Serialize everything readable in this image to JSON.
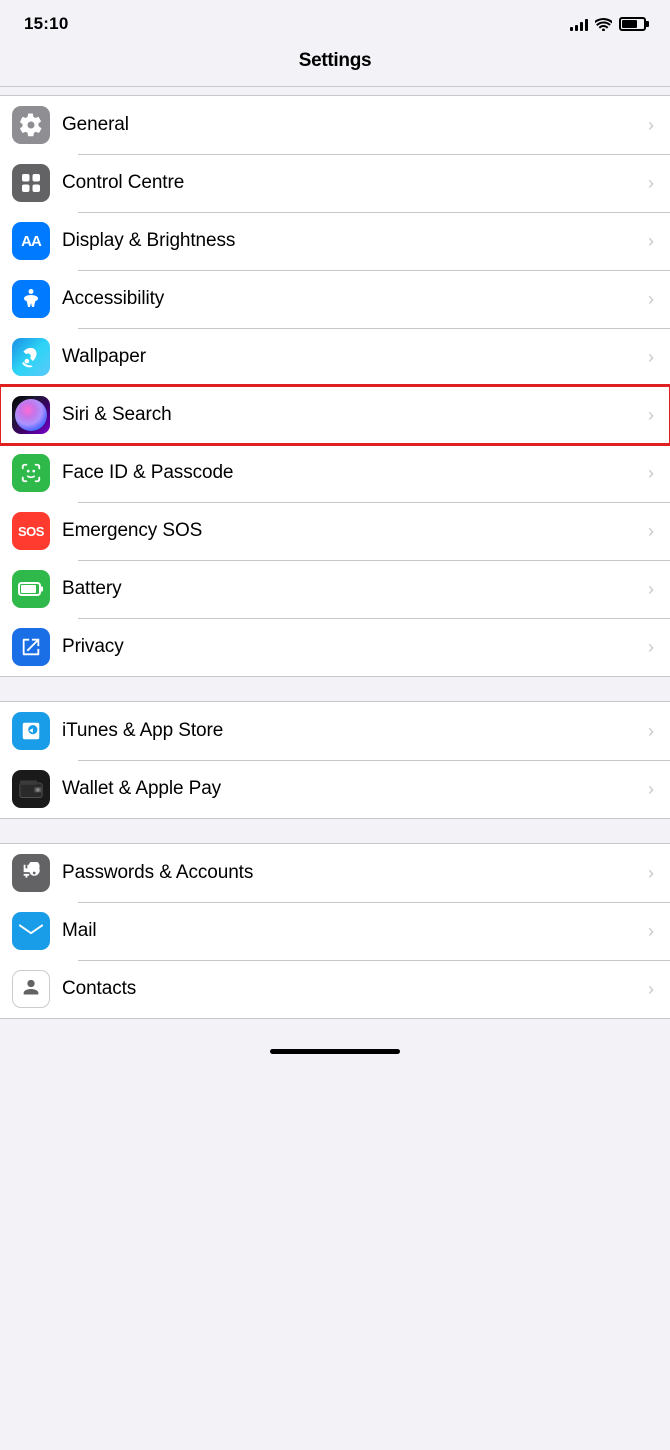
{
  "statusBar": {
    "time": "15:10",
    "signalBars": [
      4,
      6,
      8,
      11,
      14
    ],
    "batteryLevel": 70
  },
  "nav": {
    "title": "Settings"
  },
  "groups": [
    {
      "id": "group1",
      "items": [
        {
          "id": "general",
          "label": "General",
          "iconBg": "gray",
          "iconType": "gear"
        },
        {
          "id": "control-centre",
          "label": "Control Centre",
          "iconBg": "gray",
          "iconType": "toggle"
        },
        {
          "id": "display-brightness",
          "label": "Display & Brightness",
          "iconBg": "blue",
          "iconType": "text-aa"
        },
        {
          "id": "accessibility",
          "label": "Accessibility",
          "iconBg": "blue",
          "iconType": "person-circle"
        },
        {
          "id": "wallpaper",
          "label": "Wallpaper",
          "iconBg": "blue2",
          "iconType": "flower"
        },
        {
          "id": "siri-search",
          "label": "Siri & Search",
          "iconBg": "siri",
          "iconType": "siri",
          "highlighted": true
        },
        {
          "id": "face-id",
          "label": "Face ID & Passcode",
          "iconBg": "green",
          "iconType": "face-id"
        },
        {
          "id": "emergency-sos",
          "label": "Emergency SOS",
          "iconBg": "red",
          "iconType": "sos"
        },
        {
          "id": "battery",
          "label": "Battery",
          "iconBg": "green",
          "iconType": "battery"
        },
        {
          "id": "privacy",
          "label": "Privacy",
          "iconBg": "blue3",
          "iconType": "hand"
        }
      ]
    },
    {
      "id": "group2",
      "items": [
        {
          "id": "itunes-app-store",
          "label": "iTunes & App Store",
          "iconBg": "blue",
          "iconType": "app-store"
        },
        {
          "id": "wallet-apple-pay",
          "label": "Wallet & Apple Pay",
          "iconBg": "dark",
          "iconType": "wallet"
        }
      ]
    },
    {
      "id": "group3",
      "items": [
        {
          "id": "passwords-accounts",
          "label": "Passwords & Accounts",
          "iconBg": "gray2",
          "iconType": "key"
        },
        {
          "id": "mail",
          "label": "Mail",
          "iconBg": "blue",
          "iconType": "mail"
        },
        {
          "id": "contacts",
          "label": "Contacts",
          "iconBg": "contacts",
          "iconType": "contacts"
        }
      ]
    }
  ],
  "chevron": "›"
}
